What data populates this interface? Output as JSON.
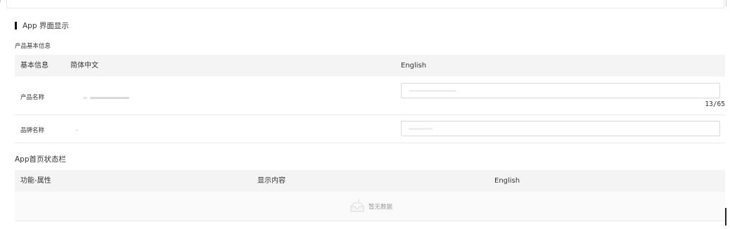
{
  "app_display": {
    "section_title": "App 界面显示",
    "sub_heading": "产品基本信息",
    "table": {
      "headers": {
        "basic_info": "基本信息",
        "chinese": "简体中文",
        "english": "English"
      },
      "rows": [
        {
          "label": "产品名称",
          "char_count": "13/65"
        },
        {
          "label": "品牌名称"
        }
      ]
    }
  },
  "status_bar": {
    "heading": "App首页状态栏",
    "headers": {
      "function_attr": "功能-属性",
      "display_content": "显示内容",
      "english": "English"
    },
    "empty_text": "暂无数据"
  }
}
